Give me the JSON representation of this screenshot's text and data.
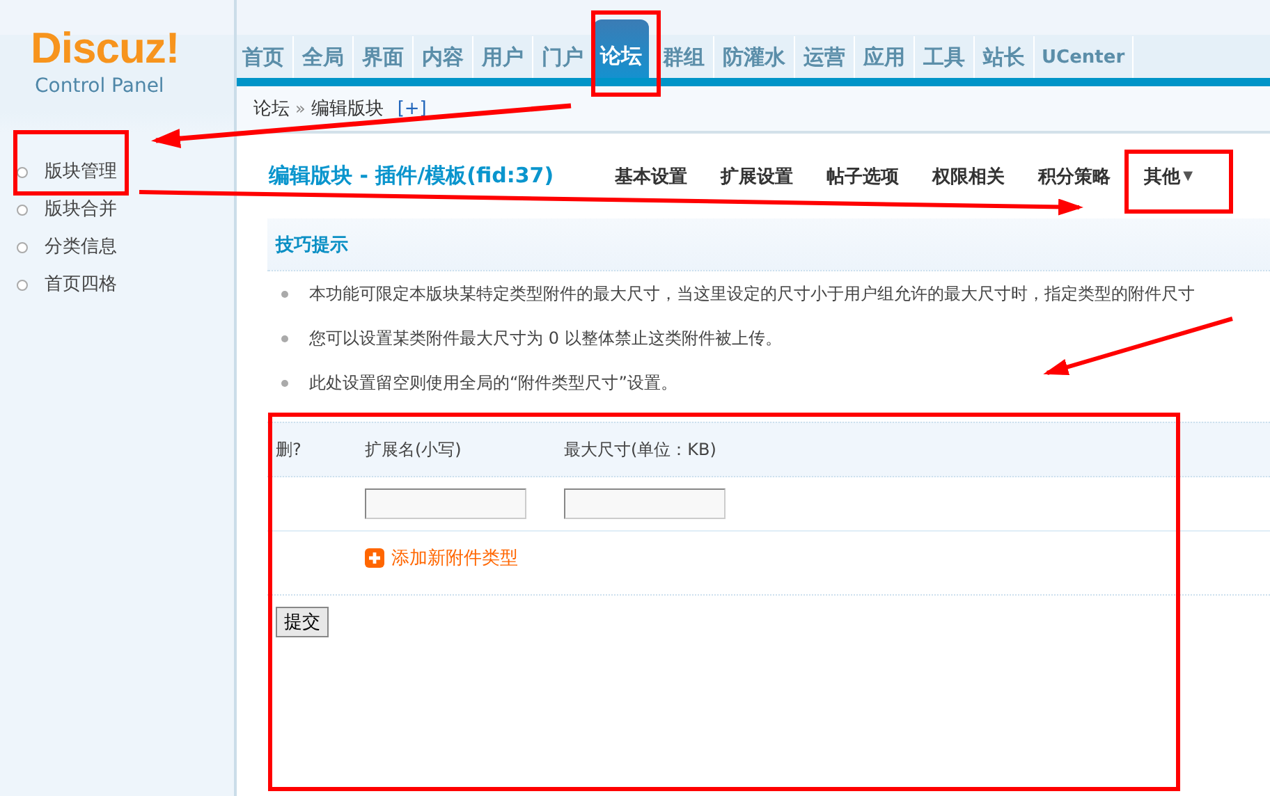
{
  "logo": {
    "name": "Discuz!",
    "subtitle": "Control Panel"
  },
  "nav": [
    {
      "label": "首页",
      "selected": false
    },
    {
      "label": "全局",
      "selected": false
    },
    {
      "label": "界面",
      "selected": false
    },
    {
      "label": "内容",
      "selected": false
    },
    {
      "label": "用户",
      "selected": false
    },
    {
      "label": "门户",
      "selected": false
    },
    {
      "label": "论坛",
      "selected": true
    },
    {
      "label": "群组",
      "selected": false
    },
    {
      "label": "防灌水",
      "selected": false
    },
    {
      "label": "运营",
      "selected": false
    },
    {
      "label": "应用",
      "selected": false
    },
    {
      "label": "工具",
      "selected": false
    },
    {
      "label": "站长",
      "selected": false
    },
    {
      "label": "UCenter",
      "selected": false
    }
  ],
  "sidebar": {
    "items": [
      {
        "label": "版块管理"
      },
      {
        "label": "版块合并"
      },
      {
        "label": "分类信息"
      },
      {
        "label": "首页四格"
      }
    ]
  },
  "breadcrumb": {
    "items": [
      "论坛",
      "编辑版块"
    ],
    "separator": "»",
    "expand": "[+]"
  },
  "page_title": "编辑版块 - 插件/模板(fid:37)",
  "subtabs": [
    {
      "label": "基本设置"
    },
    {
      "label": "扩展设置"
    },
    {
      "label": "帖子选项"
    },
    {
      "label": "权限相关"
    },
    {
      "label": "积分策略"
    },
    {
      "label": "其他",
      "caret": "▼"
    }
  ],
  "tips": {
    "title": "技巧提示",
    "items": [
      "本功能可限定本版块某特定类型附件的最大尺寸，当这里设定的尺寸小于用户组允许的最大尺寸时，指定类型的附件尺寸",
      "您可以设置某类附件最大尺寸为 0 以整体禁止这类附件被上传。",
      "此处设置留空则使用全局的“附件类型尺寸”设置。"
    ]
  },
  "table": {
    "columns": [
      "删?",
      "扩展名(小写)",
      "最大尺寸(单位：KB)"
    ],
    "add_link": "添加新附件类型"
  },
  "submit": "提交"
}
